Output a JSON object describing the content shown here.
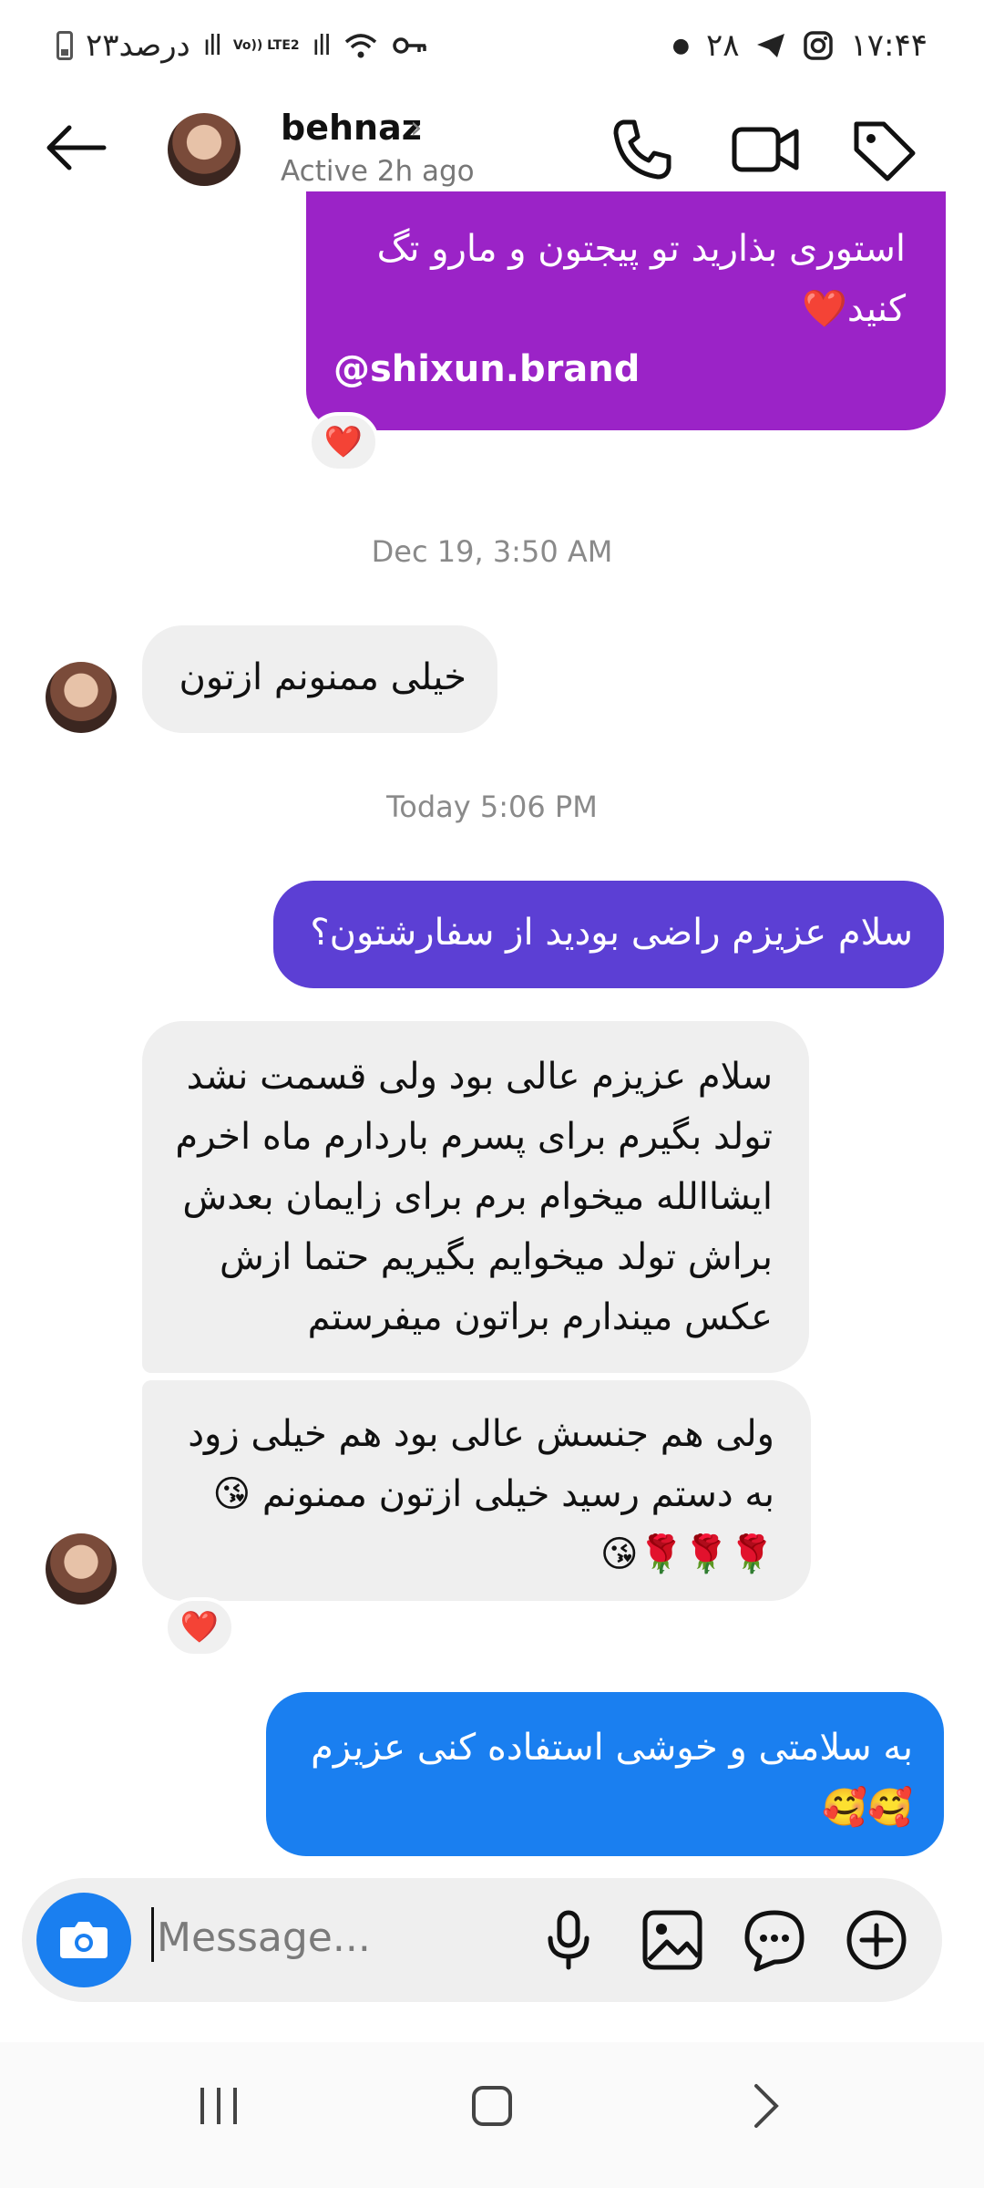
{
  "status_bar": {
    "battery_text": "۲۳درصد",
    "network_label": "Vo)) LTE2",
    "date": "۲۸",
    "time": "۱۷:۴۴"
  },
  "header": {
    "contact_name": "behnaz",
    "status": "Active 2h ago"
  },
  "messages": [
    {
      "type": "outgoing",
      "color": "#9b23c7",
      "lines": [
        "استوری بذارید تو پیجتون و مارو تگ",
        "کنید❤️"
      ],
      "handle": "@shixun.brand",
      "reaction": "❤️"
    },
    {
      "type": "timestamp",
      "text": "Dec 19, 3:50 AM"
    },
    {
      "type": "incoming",
      "lines": [
        "خیلی ممنونم ازتون"
      ]
    },
    {
      "type": "timestamp",
      "text": "Today 5:06 PM"
    },
    {
      "type": "outgoing",
      "color": "#5c3fd4",
      "lines": [
        "سلام عزیزم راضی بودید از سفارشتون؟"
      ]
    },
    {
      "type": "incoming",
      "lines": [
        "سلام عزیزم عالی بود ولی قسمت نشد",
        "تولد بگیرم برای پسرم باردارم ماه اخرم",
        "ایشاالله میخوام برم برای زایمان بعدش",
        "براش تولد میخوایم بگیریم حتما ازش",
        "عکس میندارم براتون میفرستم"
      ]
    },
    {
      "type": "incoming",
      "lines": [
        "ولی هم جنسش عالی بود هم خیلی زود",
        "به دستم رسید خیلی ازتون ممنونم 😘",
        "🌹🌹🌹😘"
      ],
      "reaction": "❤️"
    },
    {
      "type": "outgoing",
      "color": "#1a7ff0",
      "lines": [
        "به سلامتی و خوشی استفاده کنی عزیزم",
        "🥰🥰"
      ]
    }
  ],
  "composer": {
    "placeholder": "Message..."
  },
  "icons": {
    "back": "back-arrow-icon",
    "call": "phone-icon",
    "video": "video-camera-icon",
    "tag": "tag-icon",
    "camera": "camera-icon",
    "mic": "microphone-icon",
    "gallery": "image-icon",
    "sticker": "chat-sticker-icon",
    "plus": "plus-icon",
    "nav_recent": "recent-apps-icon",
    "nav_home": "home-icon",
    "nav_back": "nav-back-icon"
  }
}
